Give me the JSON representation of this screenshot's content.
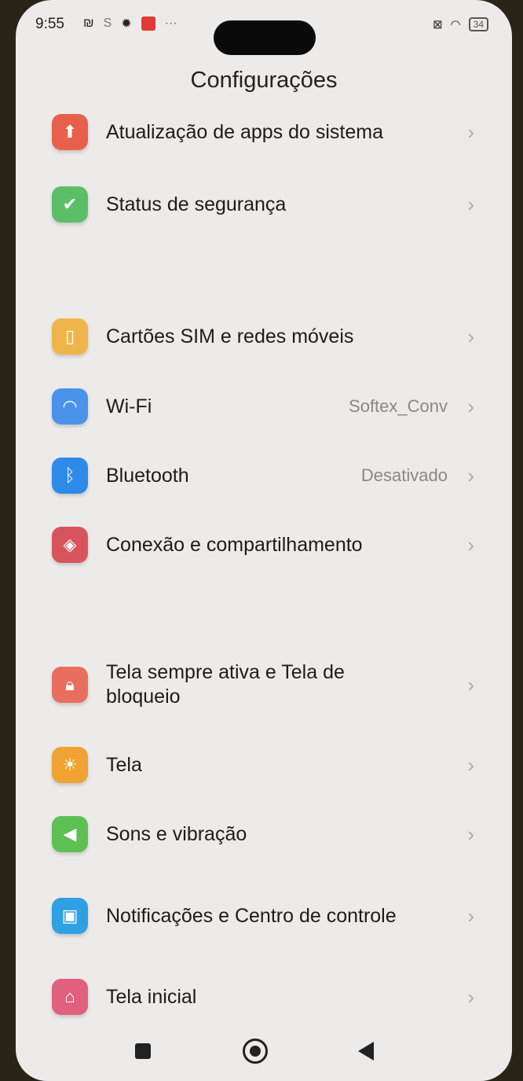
{
  "status": {
    "time": "9:55",
    "battery": "34"
  },
  "title": "Configurações",
  "items": [
    {
      "label": "Atualização de apps do sistema",
      "value": "",
      "icon": "arrow-up-icon",
      "color": "#e8604c"
    },
    {
      "label": "Status de segurança",
      "value": "",
      "icon": "shield-check-icon",
      "color": "#5cbf68"
    },
    {
      "label": "Cartões SIM e redes móveis",
      "value": "",
      "icon": "sim-card-icon",
      "color": "#f0b54a"
    },
    {
      "label": "Wi-Fi",
      "value": "Softex_Conv",
      "icon": "wifi-icon",
      "color": "#4a92ea"
    },
    {
      "label": "Bluetooth",
      "value": "Desativado",
      "icon": "bluetooth-icon",
      "color": "#2d8ae8"
    },
    {
      "label": "Conexão e compartilhamento",
      "value": "",
      "icon": "connection-icon",
      "color": "#d8545c"
    },
    {
      "label": "Tela sempre ativa e Tela de bloqueio",
      "value": "",
      "icon": "lock-icon",
      "color": "#ea6e5e"
    },
    {
      "label": "Tela",
      "value": "",
      "icon": "brightness-icon",
      "color": "#f0a232"
    },
    {
      "label": "Sons e vibração",
      "value": "",
      "icon": "speaker-icon",
      "color": "#5cc052"
    },
    {
      "label": "Notificações e Centro de controle",
      "value": "",
      "icon": "notification-icon",
      "color": "#2fa0e2"
    },
    {
      "label": "Tela inicial",
      "value": "",
      "icon": "home-icon",
      "color": "#e0607e"
    }
  ]
}
